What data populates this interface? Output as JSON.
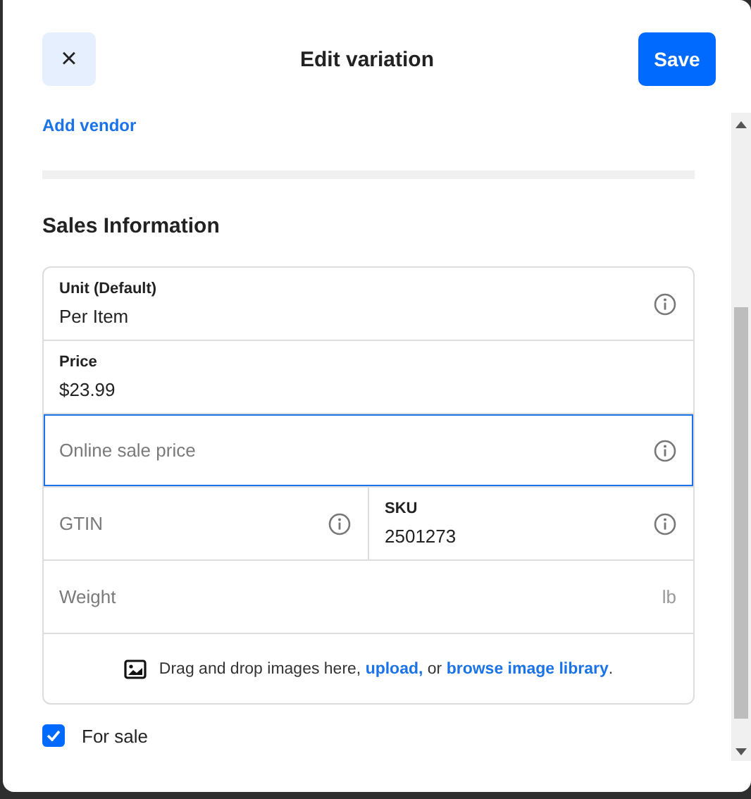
{
  "header": {
    "title": "Edit variation",
    "close_label": "×",
    "save_label": "Save"
  },
  "add_vendor_link": "Add vendor",
  "section_title": "Sales Information",
  "field_rows": [
    {
      "cells": [
        {
          "kind": "filled",
          "label": "Unit (Default)",
          "value": "Per Item",
          "info": true,
          "focused": false
        }
      ]
    },
    {
      "cells": [
        {
          "kind": "filled",
          "label": "Price",
          "value": "$23.99",
          "info": false,
          "focused": false
        }
      ]
    },
    {
      "cells": [
        {
          "kind": "empty",
          "placeholder": "Online sale price",
          "info": true,
          "focused": true
        }
      ]
    },
    {
      "cells": [
        {
          "kind": "empty",
          "placeholder": "GTIN",
          "info": true,
          "focused": false
        },
        {
          "kind": "filled",
          "label": "SKU",
          "value": "2501273",
          "info": true,
          "focused": false
        }
      ]
    },
    {
      "cells": [
        {
          "kind": "empty",
          "placeholder": "Weight",
          "suffix": "lb",
          "info": false,
          "focused": false
        }
      ]
    }
  ],
  "drop_zone": {
    "parts": [
      {
        "kind": "text",
        "text": "Drag and drop images here, "
      },
      {
        "kind": "link",
        "text": "upload,"
      },
      {
        "kind": "text",
        "text": " or "
      },
      {
        "kind": "link",
        "text": "browse image library"
      },
      {
        "kind": "text",
        "text": "."
      }
    ]
  },
  "for_sale": {
    "label": "For sale",
    "checked": true
  }
}
